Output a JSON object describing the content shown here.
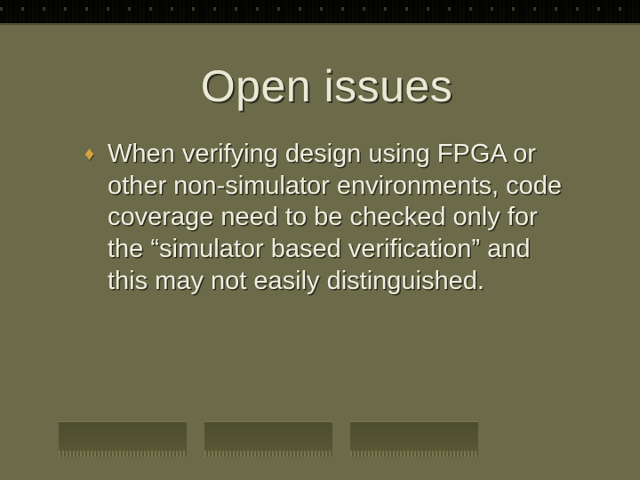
{
  "slide": {
    "title": "Open issues",
    "bullet_glyph": "♦",
    "body": "When verifying design using FPGA or other non-simulator environments, code coverage need to be checked only for the “simulator based verification” and this may not easily distinguished."
  },
  "colors": {
    "background": "#6b6b4a",
    "title": "#e9e9d6",
    "text": "#ececdf",
    "bullet": "#d6a23e"
  }
}
